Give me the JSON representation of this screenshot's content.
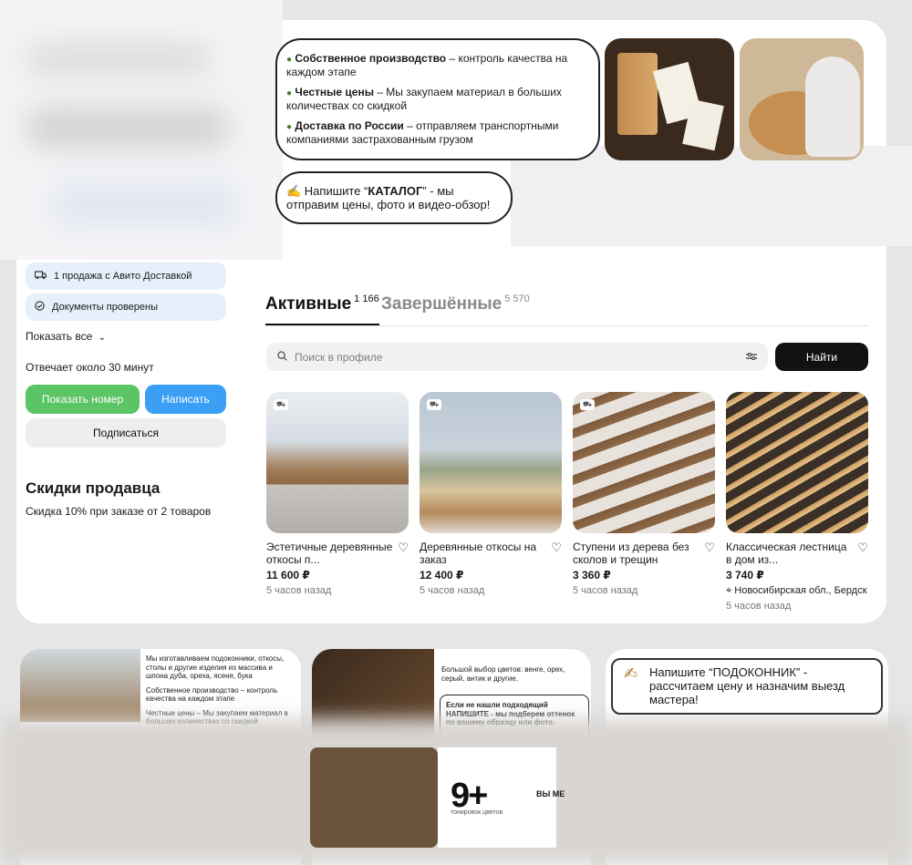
{
  "promo": {
    "line1_bold": "Собственное производство",
    "line1_rest": " – контроль качества на каждом этапе",
    "line2_bold": "Честные цены",
    "line2_rest": " – Мы закупаем материал в больших количествах со скидкой",
    "line3_bold": "Доставка по России",
    "line3_rest": " – отправляем транспортными компаниями застрахованным грузом",
    "catalog_prefix": "✍️ Напишите “",
    "catalog_word": "КАТАЛОГ",
    "catalog_suffix": "” - мы отправим цены, фото и видео-обзор!"
  },
  "seller": {
    "delivery_chip": "1 продажа с Авито Доставкой",
    "docs_chip": "Документы проверены",
    "show_all": "Показать все",
    "replies": "Отвечает около 30 минут",
    "show_phone": "Показать номер",
    "write": "Написать",
    "subscribe": "Подписаться",
    "discount_title": "Скидки продавца",
    "discount_text": "Скидка 10% при заказе от 2 товаров"
  },
  "tabs": {
    "active_label": "Активные",
    "active_count": "1 166",
    "done_label": "Завершённые",
    "done_count": "5 570"
  },
  "search": {
    "placeholder": "Поиск в профиле",
    "button": "Найти"
  },
  "listings": [
    {
      "title": "Эстетичные деревянные откосы п...",
      "price": "11 600 ₽",
      "time": "5 часов назад",
      "location": ""
    },
    {
      "title": "Деревянные откосы на заказ",
      "price": "12 400 ₽",
      "time": "5 часов назад",
      "location": ""
    },
    {
      "title": "Ступени из дерева без сколов и трещин",
      "price": "3 360 ₽",
      "time": "5 часов назад",
      "location": ""
    },
    {
      "title": "Классическая лестница в дом из...",
      "price": "3 740 ₽",
      "time": "5 часов назад",
      "location": "Новосибирская обл., Бердск"
    }
  ],
  "bottom": {
    "card1_line1": "Мы изготавливаем подоконники, откосы, столы и другие изделия из массива и шпона дуба, ореха, ясеня, бука",
    "card1_line2": "Собственное производство – контроль качества на каждом этапе",
    "card1_line3": "Честные цены – Мы закупаем материал в больших количествах со скидкой",
    "card2_line1": "Большой выбор цветов: венге, орех, серый, антик и другие.",
    "card2_line2": "Если не нашли подходящий НАПИШИТЕ - мы подберем оттенок по вашему образцу или фото.",
    "card2_count": "9+",
    "card2_caption": "тонировок цветов",
    "card2_side": "ВЫ МЕ",
    "card3_text": "Напишите “ПОДОКОННИК” - рассчитаем цену и назначим выезд мастера!"
  },
  "colors": {
    "green_button": "#5bc465",
    "blue_button": "#3a9ff5",
    "chip_bg": "#e6f0fb",
    "dark_button": "#111111"
  }
}
